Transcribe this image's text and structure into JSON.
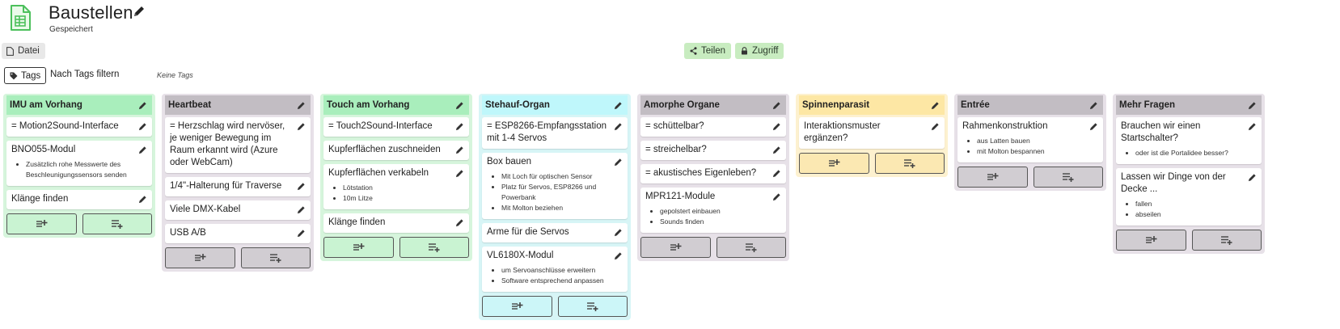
{
  "header": {
    "title": "Baustellen",
    "status": "Gespeichert",
    "file_label": "Datei",
    "share_label": "Teilen",
    "access_label": "Zugriff"
  },
  "filter": {
    "tags_label": "Tags",
    "filter_label": "Nach Tags filtern",
    "no_tags": "Keine Tags"
  },
  "colors": {
    "green_header": "#a9eebc",
    "gray_header": "#c2bdc3",
    "cyan_header": "#bff7fb",
    "yellow_header": "#fde7a4",
    "share_button": "#c8ecc0"
  },
  "icons": [
    "document-icon",
    "pencil-icon",
    "file-icon",
    "share-icon",
    "lock-icon",
    "tag-icon",
    "add-card-icon",
    "add-list-icon"
  ],
  "columns": [
    {
      "title": "IMU am Vorhang",
      "color": "green",
      "cards": [
        {
          "title": "= Motion2Sound-Interface",
          "items": []
        },
        {
          "title": "BNO055-Modul",
          "items": [
            "Zusätzlich rohe Messwerte des Beschleunigungssensors senden"
          ]
        },
        {
          "title": "Klänge finden",
          "items": []
        }
      ]
    },
    {
      "title": "Heartbeat",
      "color": "gray",
      "cards": [
        {
          "title": "= Herzschlag wird nervöser, je weniger Bewegung im Raum erkannt wird (Azure oder WebCam)",
          "items": []
        },
        {
          "title": "1/4\"-Halterung für Traverse",
          "items": []
        },
        {
          "title": "Viele DMX-Kabel",
          "items": []
        },
        {
          "title": "USB A/B",
          "items": []
        }
      ]
    },
    {
      "title": "Touch am Vorhang",
      "color": "green",
      "cards": [
        {
          "title": "= Touch2Sound-Interface",
          "items": []
        },
        {
          "title": "Kupferflächen zuschneiden",
          "items": []
        },
        {
          "title": "Kupferflächen verkabeln",
          "items": [
            "Lötstation",
            "10m Litze"
          ]
        },
        {
          "title": "Klänge finden",
          "items": []
        }
      ]
    },
    {
      "title": "Stehauf-Organ",
      "color": "cyan",
      "cards": [
        {
          "title": "= ESP8266-Empfangsstation mit 1-4 Servos",
          "items": []
        },
        {
          "title": "Box bauen",
          "items": [
            "Mit Loch für optischen Sensor",
            "Platz für Servos, ESP8266 und Powerbank",
            "Mit Molton beziehen"
          ]
        },
        {
          "title": "Arme für die Servos",
          "items": []
        },
        {
          "title": "VL6180X-Modul",
          "items": [
            "um Servoanschlüsse erweitern",
            "Software entsprechend anpassen"
          ]
        }
      ]
    },
    {
      "title": "Amorphe Organe",
      "color": "gray",
      "cards": [
        {
          "title": "= schüttelbar?",
          "items": []
        },
        {
          "title": "= streichelbar?",
          "items": []
        },
        {
          "title": "= akustisches Eigenleben?",
          "items": []
        },
        {
          "title": "MPR121-Module",
          "items": [
            "gepolstert einbauen",
            "Sounds finden"
          ]
        }
      ]
    },
    {
      "title": "Spinnenparasit",
      "color": "yellow",
      "cards": [
        {
          "title": "Interaktionsmuster ergänzen?",
          "items": []
        }
      ]
    },
    {
      "title": "Entrée",
      "color": "gray",
      "cards": [
        {
          "title": "Rahmenkonstruktion",
          "items": [
            "aus Latten bauen",
            "mit Molton bespannen"
          ]
        }
      ]
    },
    {
      "title": "Mehr Fragen",
      "color": "gray",
      "cards": [
        {
          "title": "Brauchen wir einen Startschalter?",
          "items": [
            "oder ist die Portalidee besser?"
          ]
        },
        {
          "title": "Lassen wir Dinge von der Decke ...",
          "items": [
            "fallen",
            "abseilen"
          ]
        }
      ]
    }
  ]
}
